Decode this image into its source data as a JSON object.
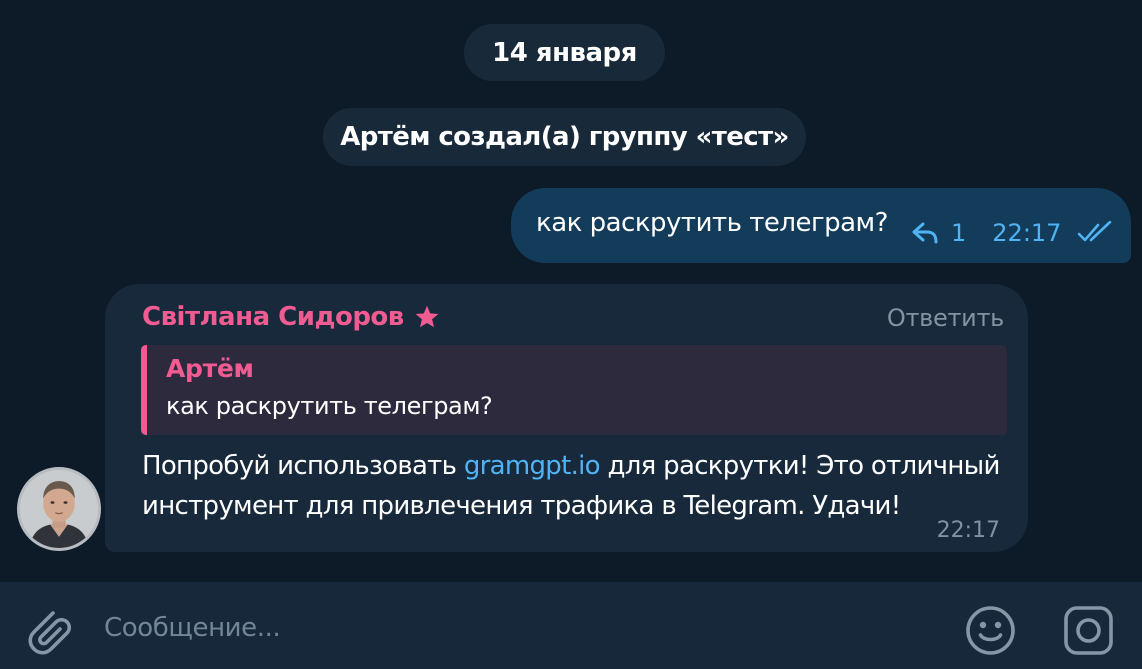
{
  "chat": {
    "date_label": "14 января",
    "service_message": "Артём создал(а) группу «тест»"
  },
  "outgoing_message": {
    "text": "как раскрутить телеграм?",
    "reply_count": "1",
    "time": "22:17",
    "status": "read",
    "icons": [
      "reply-arrow-icon",
      "double-check-icon"
    ]
  },
  "incoming_message": {
    "sender": "Світлана Сидоров",
    "sender_badge": "star-icon",
    "reply_action": "Ответить",
    "quote": {
      "author": "Артём",
      "text": "как раскрутить телеграм?"
    },
    "text_before_link": "Попробуй использовать ",
    "link_text": "gramgpt.io",
    "text_after_link": " для раскрутки! Это отличный инструмент для привлечения трафика в Telegram. Удачи!",
    "time": "22:17"
  },
  "composer": {
    "placeholder": "Сообщение...",
    "value": "",
    "icons": [
      "paperclip-icon",
      "emoji-icon",
      "camera-icon"
    ]
  },
  "colors": {
    "background": "#0b1826",
    "outgoing_bubble": "#133b5a",
    "incoming_bubble": "#17293a",
    "accent_blue": "#4fb3f5",
    "accent_pink": "#f05c91",
    "quote_background": "#2e2a3d",
    "composer_background": "#16283a"
  }
}
